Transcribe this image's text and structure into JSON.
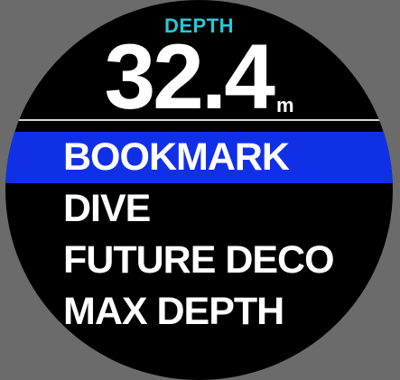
{
  "header": {
    "depth_label": "DEPTH",
    "depth_value": "32.4",
    "depth_unit": "m"
  },
  "menu": {
    "items": [
      {
        "label": "BOOKMARK",
        "selected": true
      },
      {
        "label": "DIVE",
        "selected": false
      },
      {
        "label": "FUTURE DECO",
        "selected": false
      },
      {
        "label": "MAX DEPTH",
        "selected": false
      }
    ]
  },
  "colors": {
    "background": "#6b6b6b",
    "display": "#000000",
    "depth_label": "#27c8d8",
    "selection": "#1030e8",
    "text": "#ffffff"
  }
}
